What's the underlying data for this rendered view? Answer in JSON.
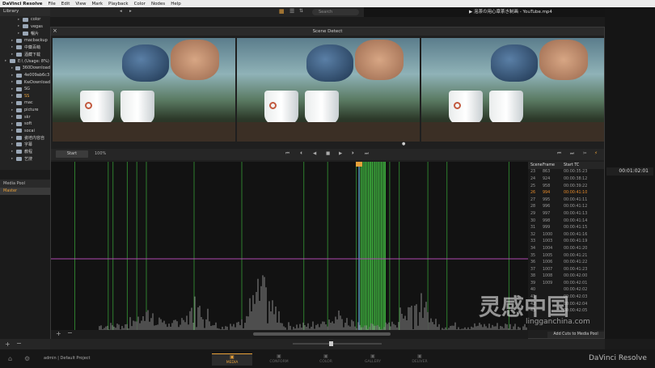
{
  "menubar": [
    "DaVinci Resolve",
    "File",
    "Edit",
    "View",
    "Mark",
    "Playback",
    "Color",
    "Nodes",
    "Help"
  ],
  "library": {
    "title": "Library",
    "tree": [
      {
        "label": "color",
        "indent": 2
      },
      {
        "label": "vegas",
        "indent": 2
      },
      {
        "label": "暢片",
        "indent": 2
      },
      {
        "label": "macbackup",
        "indent": 1
      },
      {
        "label": "中藥百萌",
        "indent": 1
      },
      {
        "label": "酒藏下载",
        "indent": 1
      },
      {
        "label": "E:\\ (Usage: 8%)",
        "indent": 0
      },
      {
        "label": "360Download",
        "indent": 1
      },
      {
        "label": "4e009ab6c3",
        "indent": 1
      },
      {
        "label": "KwDownload",
        "indent": 1
      },
      {
        "label": "SG",
        "indent": 1
      },
      {
        "label": "SS",
        "indent": 1,
        "active": true
      },
      {
        "label": "mac",
        "indent": 1
      },
      {
        "label": "picture",
        "indent": 1
      },
      {
        "label": "skr",
        "indent": 1
      },
      {
        "label": "soft",
        "indent": 1
      },
      {
        "label": "socai",
        "indent": 1
      },
      {
        "label": "瓷培内容自",
        "indent": 1
      },
      {
        "label": "字幕",
        "indent": 1
      },
      {
        "label": "教程",
        "indent": 1
      },
      {
        "label": "艺搜",
        "indent": 1
      }
    ]
  },
  "media_pool": {
    "title": "Media Pool",
    "master": "Master"
  },
  "search": {
    "placeholder": "Search"
  },
  "video_title": "▶ 泡茶の用心章茶き制画 - YouTube.mp4",
  "dialog": {
    "title": "Scene Detect",
    "start_label": "Start",
    "zoom": "100%",
    "add_cuts": "Add Cuts to Media Pool"
  },
  "scene_table": {
    "headers": [
      "Scene",
      "Frame",
      "Start TC"
    ],
    "rows": [
      [
        "23",
        "863",
        "00:00:35:23"
      ],
      [
        "24",
        "924",
        "00:00:38:12"
      ],
      [
        "25",
        "958",
        "00:00:39:22"
      ],
      [
        "26",
        "994",
        "00:00:41:10",
        true
      ],
      [
        "27",
        "995",
        "00:00:41:11"
      ],
      [
        "28",
        "996",
        "00:00:41:12"
      ],
      [
        "29",
        "997",
        "00:00:41:13"
      ],
      [
        "30",
        "998",
        "00:00:41:14"
      ],
      [
        "31",
        "999",
        "00:00:41:15"
      ],
      [
        "32",
        "1000",
        "00:00:41:16"
      ],
      [
        "33",
        "1003",
        "00:00:41:19"
      ],
      [
        "34",
        "1004",
        "00:00:41:20"
      ],
      [
        "35",
        "1005",
        "00:00:41:21"
      ],
      [
        "36",
        "1006",
        "00:00:41:22"
      ],
      [
        "37",
        "1007",
        "00:00:41:23"
      ],
      [
        "38",
        "1008",
        "00:00:42:00"
      ],
      [
        "39",
        "1009",
        "00:00:42:01"
      ],
      [
        "40",
        "",
        "00:00:42:02"
      ],
      [
        "41",
        "",
        "00:00:42:03"
      ],
      [
        "42",
        "",
        "00:00:42:04"
      ],
      [
        "43",
        "",
        "00:00:42:05"
      ]
    ]
  },
  "timecode": "00:01:02:01",
  "project": "admin | Default Project",
  "pages": [
    {
      "label": "MEDIA",
      "active": true
    },
    {
      "label": "CONFORM"
    },
    {
      "label": "COLOR"
    },
    {
      "label": "GALLERY"
    },
    {
      "label": "DELIVER"
    }
  ],
  "brand": "DaVinci Resolve",
  "watermark": {
    "text": "灵感中国",
    "url": "lingganchina.com"
  },
  "colors": {
    "accent": "#e8a13a",
    "cut_line": "#2e7d2e",
    "threshold": "#b04ab0"
  },
  "chart_data": {
    "type": "bar",
    "note_only": false,
    "cuts": [
      0.05,
      0.12,
      0.13,
      0.16,
      0.18,
      0.2,
      0.3,
      0.4,
      0.53,
      0.58,
      0.64,
      0.66,
      0.67,
      0.7,
      0.71,
      0.73,
      0.79,
      0.83,
      0.96
    ]
  }
}
